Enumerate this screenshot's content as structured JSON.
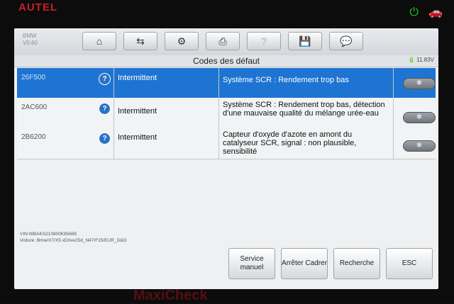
{
  "device": {
    "brand": "AUTEL",
    "bottom_brand": "MaxiCheck"
  },
  "vehicle": {
    "make": "BMW",
    "version": "V0.60"
  },
  "toolbar": {
    "buttons": [
      {
        "icon": "home-icon",
        "glyph": "⌂"
      },
      {
        "icon": "vehicle-swap-icon",
        "glyph": "⇆"
      },
      {
        "icon": "settings-icon",
        "glyph": "⚙"
      },
      {
        "icon": "printer-icon",
        "glyph": "⎙"
      },
      {
        "icon": "help-icon",
        "glyph": "?"
      },
      {
        "icon": "save-icon",
        "glyph": "💾"
      },
      {
        "icon": "message-icon",
        "glyph": "💬"
      }
    ]
  },
  "title": "Codes des défaut",
  "battery": "11.83V",
  "dtcs": [
    {
      "code": "26F500",
      "status": "Intermittent",
      "description": "Système SCR : Rendement trop bas",
      "selected": true
    },
    {
      "code": "2AC600",
      "status": "Intermittent",
      "description": "Système SCR : Rendement trop bas, détection d'une mauvaise qualité du mélange urée-eau",
      "selected": false
    },
    {
      "code": "2B6200",
      "status": "Intermittent",
      "description": "Capteur d'oxyde d'azote en amont du catalyseur SCR, signal : non plausible, sensibilité",
      "selected": false
    }
  ],
  "vin_line": "VIN:WBAKS210800K85685",
  "vehicle_line": "Voiture: Bmw/X7/X5 xDrive25d_N47/F15/EUR_D&G",
  "buttons": {
    "service": "Service manuel",
    "stop": "Arrêter Cadrer",
    "search": "Recherche",
    "esc": "ESC"
  }
}
